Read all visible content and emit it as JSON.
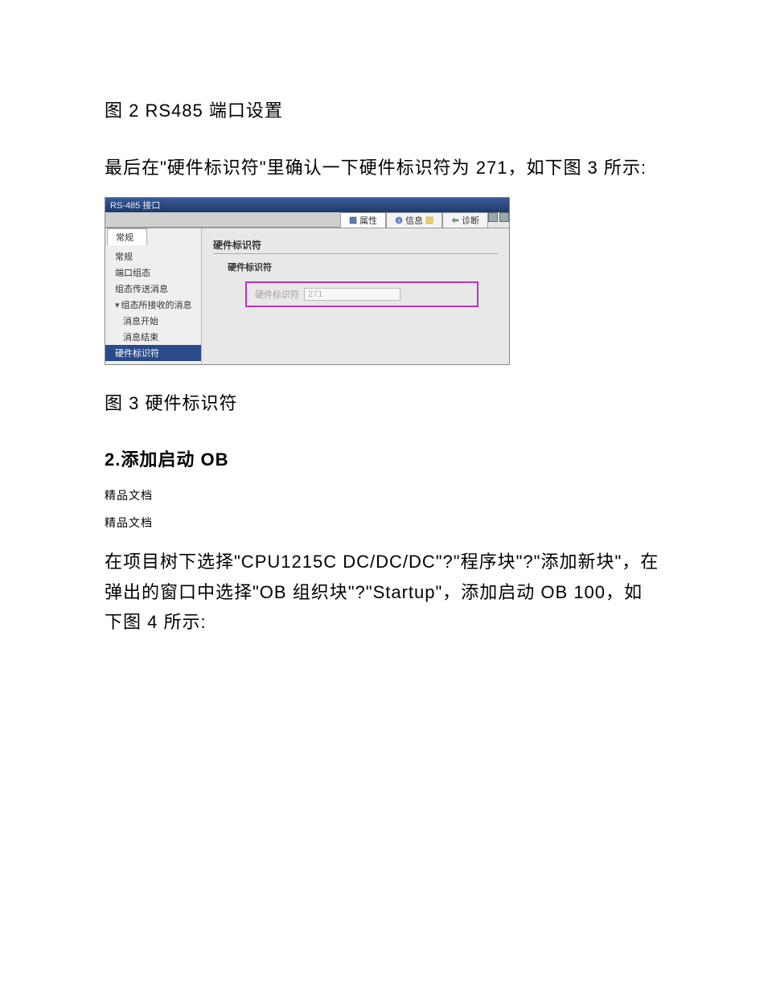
{
  "text": {
    "caption_fig2": "图 2 RS485 端口设置",
    "para1": "最后在\"硬件标识符\"里确认一下硬件标识符为 271，如下图 3 所示:",
    "caption_fig3": "图 3 硬件标识符",
    "section2": "2.添加启动 OB",
    "note1": "精品文档",
    "note2": "精品文档",
    "para2": "在项目树下选择\"CPU1215C DC/DC/DC\"?\"程序块\"?\"添加新块\"，在弹出的窗口中选择\"OB 组织块\"?\"Startup\"，添加启动 OB 100，如下图 4 所示:"
  },
  "ui": {
    "title": "RS-485 接口",
    "tabs": {
      "properties": "属性",
      "info": "信息",
      "diagnostics": "诊断"
    },
    "side": {
      "tab_general": "常规",
      "item_general": "常规",
      "item_portcfg": "端口组态",
      "item_transfermsg": "组态传送消息",
      "item_recvcfg": "组态所接收的消息",
      "item_msgstart": "消息开始",
      "item_msgend": "消息结束",
      "item_hwid": "硬件标识符"
    },
    "main": {
      "group_title": "硬件标识符",
      "sub_title": "硬件标识符",
      "field_label": "硬件标识符",
      "field_value": "271"
    }
  }
}
